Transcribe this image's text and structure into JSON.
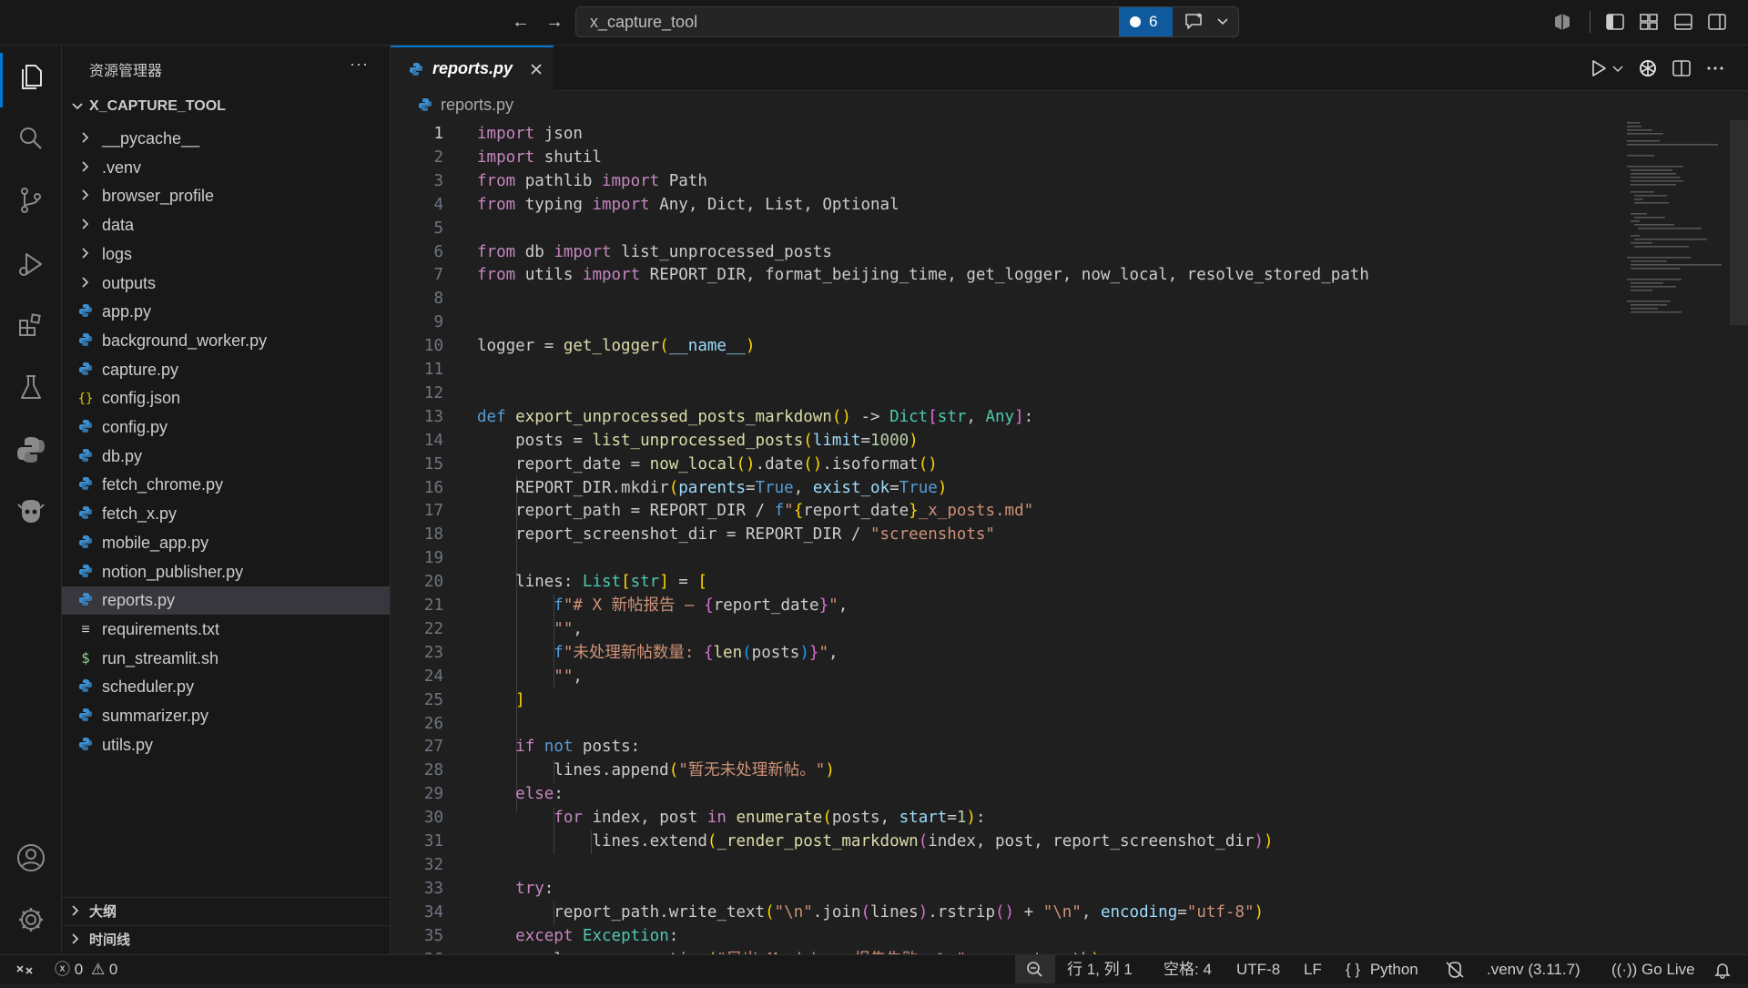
{
  "titlebar": {
    "command_center_title": "x_capture_tool",
    "notification_count": "6"
  },
  "sidebar": {
    "header": "资源管理器",
    "more": "···",
    "root": "X_CAPTURE_TOOL",
    "folders": [
      "__pycache__",
      ".venv",
      "browser_profile",
      "data",
      "logs",
      "outputs"
    ],
    "files": [
      {
        "name": "app.py",
        "icon": "python-file-icon"
      },
      {
        "name": "background_worker.py",
        "icon": "python-file-icon"
      },
      {
        "name": "capture.py",
        "icon": "python-file-icon"
      },
      {
        "name": "config.json",
        "icon": "json-file-icon"
      },
      {
        "name": "config.py",
        "icon": "python-file-icon"
      },
      {
        "name": "db.py",
        "icon": "python-file-icon"
      },
      {
        "name": "fetch_chrome.py",
        "icon": "python-file-icon"
      },
      {
        "name": "fetch_x.py",
        "icon": "python-file-icon"
      },
      {
        "name": "mobile_app.py",
        "icon": "python-file-icon"
      },
      {
        "name": "notion_publisher.py",
        "icon": "python-file-icon"
      },
      {
        "name": "reports.py",
        "icon": "python-file-icon",
        "selected": true
      },
      {
        "name": "requirements.txt",
        "icon": "text-file-icon"
      },
      {
        "name": "run_streamlit.sh",
        "icon": "shell-file-icon"
      },
      {
        "name": "scheduler.py",
        "icon": "python-file-icon"
      },
      {
        "name": "summarizer.py",
        "icon": "python-file-icon"
      },
      {
        "name": "utils.py",
        "icon": "python-file-icon"
      }
    ],
    "outline_label": "大纲",
    "timeline_label": "时间线"
  },
  "editor": {
    "tab_label": "reports.py",
    "breadcrumb": "reports.py",
    "current_line": 1,
    "lines": [
      [
        [
          "kc",
          "import"
        ],
        [
          "",
          " json"
        ]
      ],
      [
        [
          "kc",
          "import"
        ],
        [
          "",
          " shutil"
        ]
      ],
      [
        [
          "kc",
          "from"
        ],
        [
          "",
          " pathlib "
        ],
        [
          "kc",
          "import"
        ],
        [
          "",
          " Path"
        ]
      ],
      [
        [
          "kc",
          "from"
        ],
        [
          "",
          " typing "
        ],
        [
          "kc",
          "import"
        ],
        [
          "",
          " Any, Dict, List, Optional"
        ]
      ],
      [],
      [
        [
          "kc",
          "from"
        ],
        [
          "",
          " db "
        ],
        [
          "kc",
          "import"
        ],
        [
          "",
          " list_unprocessed_posts"
        ]
      ],
      [
        [
          "kc",
          "from"
        ],
        [
          "",
          " utils "
        ],
        [
          "kc",
          "import"
        ],
        [
          "",
          " REPORT_DIR, format_beijing_time, get_logger, now_local, resolve_stored_path"
        ]
      ],
      [],
      [],
      [
        [
          "",
          "logger = "
        ],
        [
          "fn",
          "get_logger"
        ],
        [
          "bk1",
          "("
        ],
        [
          "pr",
          "__name__"
        ],
        [
          "bk1",
          ")"
        ]
      ],
      [],
      [],
      [
        [
          "kw",
          "def"
        ],
        [
          "",
          " "
        ],
        [
          "fn",
          "export_unprocessed_posts_markdown"
        ],
        [
          "bk1",
          "()"
        ],
        [
          "",
          " -> "
        ],
        [
          "ty",
          "Dict"
        ],
        [
          "bk2",
          "["
        ],
        [
          "ty",
          "str"
        ],
        [
          "",
          ", "
        ],
        [
          "ty",
          "Any"
        ],
        [
          "bk2",
          "]"
        ],
        [
          "",
          ":"
        ]
      ],
      [
        [
          "",
          "    posts = "
        ],
        [
          "fn",
          "list_unprocessed_posts"
        ],
        [
          "bk1",
          "("
        ],
        [
          "pr",
          "limit"
        ],
        [
          "",
          "="
        ],
        [
          "nm",
          "1000"
        ],
        [
          "bk1",
          ")"
        ]
      ],
      [
        [
          "",
          "    report_date = "
        ],
        [
          "fn",
          "now_local"
        ],
        [
          "bk1",
          "()"
        ],
        [
          "",
          ".date"
        ],
        [
          "bk1",
          "()"
        ],
        [
          "",
          ".isoformat"
        ],
        [
          "bk1",
          "()"
        ]
      ],
      [
        [
          "",
          "    REPORT_DIR.mkdir"
        ],
        [
          "bk1",
          "("
        ],
        [
          "pr",
          "parents"
        ],
        [
          "",
          "="
        ],
        [
          "kw",
          "True"
        ],
        [
          "",
          ", "
        ],
        [
          "pr",
          "exist_ok"
        ],
        [
          "",
          "="
        ],
        [
          "kw",
          "True"
        ],
        [
          "bk1",
          ")"
        ]
      ],
      [
        [
          "",
          "    report_path = REPORT_DIR / "
        ],
        [
          "kw",
          "f"
        ],
        [
          "st",
          "\""
        ],
        [
          "bk1",
          "{"
        ],
        [
          "",
          "report_date"
        ],
        [
          "bk1",
          "}"
        ],
        [
          "st",
          "_x_posts.md\""
        ]
      ],
      [
        [
          "",
          "    report_screenshot_dir = REPORT_DIR / "
        ],
        [
          "st",
          "\"screenshots\""
        ]
      ],
      [],
      [
        [
          "",
          "    lines: "
        ],
        [
          "ty",
          "List"
        ],
        [
          "bk1",
          "["
        ],
        [
          "ty",
          "str"
        ],
        [
          "bk1",
          "]"
        ],
        [
          "",
          " = "
        ],
        [
          "bk1",
          "["
        ]
      ],
      [
        [
          "",
          "        "
        ],
        [
          "kw",
          "f"
        ],
        [
          "st",
          "\"# X 新帖报告 — "
        ],
        [
          "bk2",
          "{"
        ],
        [
          "",
          "report_date"
        ],
        [
          "bk2",
          "}"
        ],
        [
          "st",
          "\""
        ],
        [
          "",
          ","
        ]
      ],
      [
        [
          "",
          "        "
        ],
        [
          "st",
          "\"\""
        ],
        [
          "",
          ","
        ]
      ],
      [
        [
          "",
          "        "
        ],
        [
          "kw",
          "f"
        ],
        [
          "st",
          "\"未处理新帖数量: "
        ],
        [
          "bk2",
          "{"
        ],
        [
          "fn",
          "len"
        ],
        [
          "bk3",
          "("
        ],
        [
          "",
          "posts"
        ],
        [
          "bk3",
          ")"
        ],
        [
          "bk2",
          "}"
        ],
        [
          "st",
          "\""
        ],
        [
          "",
          ","
        ]
      ],
      [
        [
          "",
          "        "
        ],
        [
          "st",
          "\"\""
        ],
        [
          "",
          ","
        ]
      ],
      [
        [
          "",
          "    "
        ],
        [
          "bk1",
          "]"
        ]
      ],
      [],
      [
        [
          "",
          "    "
        ],
        [
          "kc",
          "if"
        ],
        [
          "",
          " "
        ],
        [
          "kw",
          "not"
        ],
        [
          "",
          " posts:"
        ]
      ],
      [
        [
          "",
          "        lines.append"
        ],
        [
          "bk1",
          "("
        ],
        [
          "st",
          "\"暂无未处理新帖。\""
        ],
        [
          "bk1",
          ")"
        ]
      ],
      [
        [
          "",
          "    "
        ],
        [
          "kc",
          "else"
        ],
        [
          "",
          ":"
        ]
      ],
      [
        [
          "",
          "        "
        ],
        [
          "kc",
          "for"
        ],
        [
          "",
          " index, post "
        ],
        [
          "kc",
          "in"
        ],
        [
          "",
          " "
        ],
        [
          "fn",
          "enumerate"
        ],
        [
          "bk1",
          "("
        ],
        [
          "",
          "posts, "
        ],
        [
          "pr",
          "start"
        ],
        [
          "",
          "="
        ],
        [
          "nm",
          "1"
        ],
        [
          "bk1",
          ")"
        ],
        [
          "",
          ":"
        ]
      ],
      [
        [
          "",
          "            lines.extend"
        ],
        [
          "bk1",
          "("
        ],
        [
          "fn",
          "_render_post_markdown"
        ],
        [
          "bk2",
          "("
        ],
        [
          "",
          "index, post, report_screenshot_dir"
        ],
        [
          "bk2",
          ")"
        ],
        [
          "bk1",
          ")"
        ]
      ],
      [],
      [
        [
          "",
          "    "
        ],
        [
          "kc",
          "try"
        ],
        [
          "",
          ":"
        ]
      ],
      [
        [
          "",
          "        report_path.write_text"
        ],
        [
          "bk1",
          "("
        ],
        [
          "st",
          "\"\\n\""
        ],
        [
          "",
          ".join"
        ],
        [
          "bk2",
          "("
        ],
        [
          "",
          "lines"
        ],
        [
          "bk2",
          ")"
        ],
        [
          "",
          ".rstrip"
        ],
        [
          "bk2",
          "()"
        ],
        [
          "",
          " + "
        ],
        [
          "st",
          "\"\\n\""
        ],
        [
          "",
          ", "
        ],
        [
          "pr",
          "encoding"
        ],
        [
          "",
          "="
        ],
        [
          "st",
          "\"utf-8\""
        ],
        [
          "bk1",
          ")"
        ]
      ],
      [
        [
          "",
          "    "
        ],
        [
          "kc",
          "except"
        ],
        [
          "",
          " "
        ],
        [
          "ty",
          "Exception"
        ],
        [
          "",
          ":"
        ]
      ],
      [
        [
          "",
          "        logger.exception"
        ],
        [
          "bk1",
          "("
        ],
        [
          "st",
          "\"导出 Markdown 报告失败: %s\""
        ],
        [
          "",
          ", report_path"
        ],
        [
          "bk1",
          ")"
        ]
      ]
    ]
  },
  "statusbar": {
    "errors": "0",
    "warnings": "0",
    "cursor": "行 1, 列 1",
    "indent": "空格: 4",
    "encoding": "UTF-8",
    "eol": "LF",
    "language": "Python",
    "interpreter": ".venv (3.11.7)",
    "golive": "Go Live"
  },
  "colors": {
    "accent": "#0078d4",
    "badge": "#0e5a9c",
    "python_icon": "#3b8fd1",
    "json_icon": "#e2c100",
    "shell_icon": "#89d185"
  }
}
